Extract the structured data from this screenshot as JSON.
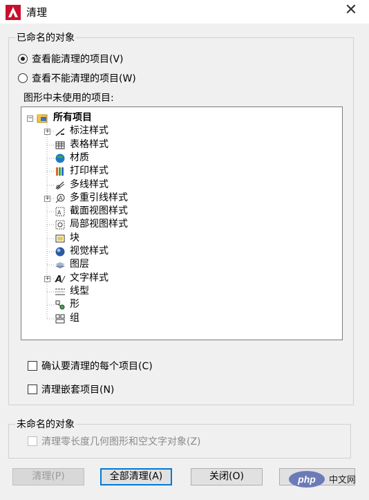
{
  "window": {
    "title": "清理",
    "close_glyph": "✕"
  },
  "named_group": {
    "label": "已命名的对象",
    "radio_purgeable": "查看能清理的项目(V)",
    "radio_not_purgeable": "查看不能清理的项目(W)",
    "tree_label": "图形中未使用的项目:"
  },
  "tree": {
    "root": {
      "label": "所有项目",
      "expander": "−",
      "icon": "folder-icon"
    },
    "items": [
      {
        "label": "标注样式",
        "icon": "dimension-style-icon",
        "expandable": true
      },
      {
        "label": "表格样式",
        "icon": "table-style-icon",
        "expandable": false
      },
      {
        "label": "材质",
        "icon": "material-icon",
        "expandable": false
      },
      {
        "label": "打印样式",
        "icon": "plot-style-icon",
        "expandable": false
      },
      {
        "label": "多线样式",
        "icon": "multiline-style-icon",
        "expandable": false
      },
      {
        "label": "多重引线样式",
        "icon": "multileader-style-icon",
        "expandable": true
      },
      {
        "label": "截面视图样式",
        "icon": "section-view-style-icon",
        "expandable": false
      },
      {
        "label": "局部视图样式",
        "icon": "detail-view-style-icon",
        "expandable": false
      },
      {
        "label": "块",
        "icon": "block-icon",
        "expandable": false
      },
      {
        "label": "视觉样式",
        "icon": "visual-style-icon",
        "expandable": false
      },
      {
        "label": "图层",
        "icon": "layer-icon",
        "expandable": false
      },
      {
        "label": "文字样式",
        "icon": "text-style-icon",
        "expandable": true
      },
      {
        "label": "线型",
        "icon": "linetype-icon",
        "expandable": false
      },
      {
        "label": "形",
        "icon": "shape-icon",
        "expandable": false
      },
      {
        "label": "组",
        "icon": "group-icon",
        "expandable": false
      }
    ]
  },
  "options": {
    "confirm_each": "确认要清理的每个项目(C)",
    "purge_nested": "清理嵌套项目(N)"
  },
  "unnamed_group": {
    "label": "未命名的对象",
    "zero_length": "清理零长度几何图形和空文字对象(Z)"
  },
  "buttons": {
    "purge": "清理(P)",
    "purge_all": "全部清理(A)",
    "close": "关闭(O)"
  },
  "watermark": {
    "text1": "php",
    "text2": "中文网"
  },
  "colors": {
    "accent": "#0078d7",
    "app_red": "#c8102e"
  }
}
